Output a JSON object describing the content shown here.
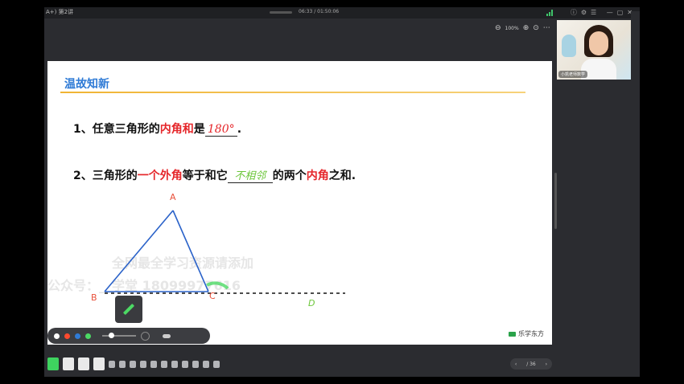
{
  "window": {
    "title": "A+) 第2讲",
    "time": "06:33 / 01:50:06",
    "zoom": "100%"
  },
  "slide": {
    "heading": "温故知新",
    "q1": {
      "prefix": "1、任意三角形的",
      "red": "内角和",
      "suffix": "是",
      "answer": "180°",
      "end": "."
    },
    "q2": {
      "prefix": "2、三角形的",
      "red1": "一个外角",
      "mid": "等于和它",
      "answer": "不相邻",
      "mid2": "的两个",
      "red2": "内角",
      "end": "之和."
    },
    "points": {
      "a": "A",
      "b": "B",
      "c": "C",
      "d": "D"
    },
    "watermark1": "全网最全学习资源请添加",
    "watermark2": "公众号：__学堂 18099977616",
    "brand": "乐学东方"
  },
  "pager": {
    "label": "/ 36"
  },
  "video": {
    "name": "小凯老师数学"
  },
  "colors": {
    "accent": "#2f7bd6",
    "red": "#e5262a",
    "green": "#4cd964",
    "underline": "#f0b433"
  }
}
